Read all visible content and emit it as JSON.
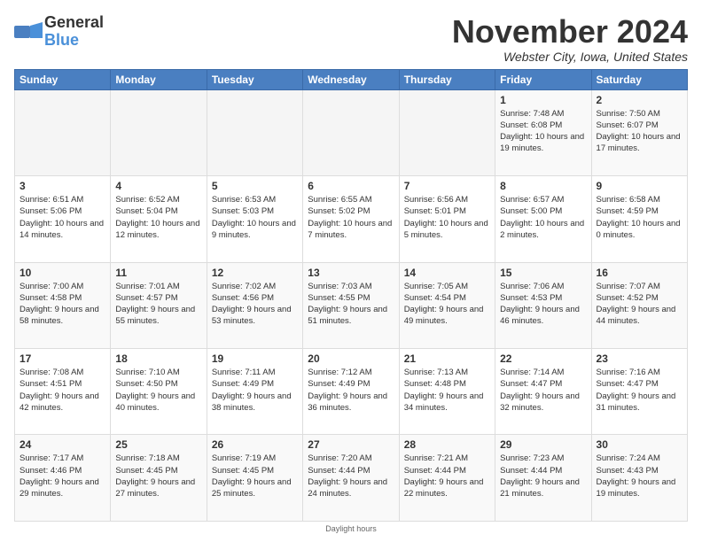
{
  "header": {
    "logo_general": "General",
    "logo_blue": "Blue",
    "month_title": "November 2024",
    "location": "Webster City, Iowa, United States"
  },
  "days_of_week": [
    "Sunday",
    "Monday",
    "Tuesday",
    "Wednesday",
    "Thursday",
    "Friday",
    "Saturday"
  ],
  "footer": {
    "label": "Daylight hours"
  },
  "weeks": [
    [
      {
        "day": "",
        "info": ""
      },
      {
        "day": "",
        "info": ""
      },
      {
        "day": "",
        "info": ""
      },
      {
        "day": "",
        "info": ""
      },
      {
        "day": "",
        "info": ""
      },
      {
        "day": "1",
        "info": "Sunrise: 7:48 AM\nSunset: 6:08 PM\nDaylight: 10 hours and 19 minutes."
      },
      {
        "day": "2",
        "info": "Sunrise: 7:50 AM\nSunset: 6:07 PM\nDaylight: 10 hours and 17 minutes."
      }
    ],
    [
      {
        "day": "3",
        "info": "Sunrise: 6:51 AM\nSunset: 5:06 PM\nDaylight: 10 hours and 14 minutes."
      },
      {
        "day": "4",
        "info": "Sunrise: 6:52 AM\nSunset: 5:04 PM\nDaylight: 10 hours and 12 minutes."
      },
      {
        "day": "5",
        "info": "Sunrise: 6:53 AM\nSunset: 5:03 PM\nDaylight: 10 hours and 9 minutes."
      },
      {
        "day": "6",
        "info": "Sunrise: 6:55 AM\nSunset: 5:02 PM\nDaylight: 10 hours and 7 minutes."
      },
      {
        "day": "7",
        "info": "Sunrise: 6:56 AM\nSunset: 5:01 PM\nDaylight: 10 hours and 5 minutes."
      },
      {
        "day": "8",
        "info": "Sunrise: 6:57 AM\nSunset: 5:00 PM\nDaylight: 10 hours and 2 minutes."
      },
      {
        "day": "9",
        "info": "Sunrise: 6:58 AM\nSunset: 4:59 PM\nDaylight: 10 hours and 0 minutes."
      }
    ],
    [
      {
        "day": "10",
        "info": "Sunrise: 7:00 AM\nSunset: 4:58 PM\nDaylight: 9 hours and 58 minutes."
      },
      {
        "day": "11",
        "info": "Sunrise: 7:01 AM\nSunset: 4:57 PM\nDaylight: 9 hours and 55 minutes."
      },
      {
        "day": "12",
        "info": "Sunrise: 7:02 AM\nSunset: 4:56 PM\nDaylight: 9 hours and 53 minutes."
      },
      {
        "day": "13",
        "info": "Sunrise: 7:03 AM\nSunset: 4:55 PM\nDaylight: 9 hours and 51 minutes."
      },
      {
        "day": "14",
        "info": "Sunrise: 7:05 AM\nSunset: 4:54 PM\nDaylight: 9 hours and 49 minutes."
      },
      {
        "day": "15",
        "info": "Sunrise: 7:06 AM\nSunset: 4:53 PM\nDaylight: 9 hours and 46 minutes."
      },
      {
        "day": "16",
        "info": "Sunrise: 7:07 AM\nSunset: 4:52 PM\nDaylight: 9 hours and 44 minutes."
      }
    ],
    [
      {
        "day": "17",
        "info": "Sunrise: 7:08 AM\nSunset: 4:51 PM\nDaylight: 9 hours and 42 minutes."
      },
      {
        "day": "18",
        "info": "Sunrise: 7:10 AM\nSunset: 4:50 PM\nDaylight: 9 hours and 40 minutes."
      },
      {
        "day": "19",
        "info": "Sunrise: 7:11 AM\nSunset: 4:49 PM\nDaylight: 9 hours and 38 minutes."
      },
      {
        "day": "20",
        "info": "Sunrise: 7:12 AM\nSunset: 4:49 PM\nDaylight: 9 hours and 36 minutes."
      },
      {
        "day": "21",
        "info": "Sunrise: 7:13 AM\nSunset: 4:48 PM\nDaylight: 9 hours and 34 minutes."
      },
      {
        "day": "22",
        "info": "Sunrise: 7:14 AM\nSunset: 4:47 PM\nDaylight: 9 hours and 32 minutes."
      },
      {
        "day": "23",
        "info": "Sunrise: 7:16 AM\nSunset: 4:47 PM\nDaylight: 9 hours and 31 minutes."
      }
    ],
    [
      {
        "day": "24",
        "info": "Sunrise: 7:17 AM\nSunset: 4:46 PM\nDaylight: 9 hours and 29 minutes."
      },
      {
        "day": "25",
        "info": "Sunrise: 7:18 AM\nSunset: 4:45 PM\nDaylight: 9 hours and 27 minutes."
      },
      {
        "day": "26",
        "info": "Sunrise: 7:19 AM\nSunset: 4:45 PM\nDaylight: 9 hours and 25 minutes."
      },
      {
        "day": "27",
        "info": "Sunrise: 7:20 AM\nSunset: 4:44 PM\nDaylight: 9 hours and 24 minutes."
      },
      {
        "day": "28",
        "info": "Sunrise: 7:21 AM\nSunset: 4:44 PM\nDaylight: 9 hours and 22 minutes."
      },
      {
        "day": "29",
        "info": "Sunrise: 7:23 AM\nSunset: 4:44 PM\nDaylight: 9 hours and 21 minutes."
      },
      {
        "day": "30",
        "info": "Sunrise: 7:24 AM\nSunset: 4:43 PM\nDaylight: 9 hours and 19 minutes."
      }
    ]
  ]
}
